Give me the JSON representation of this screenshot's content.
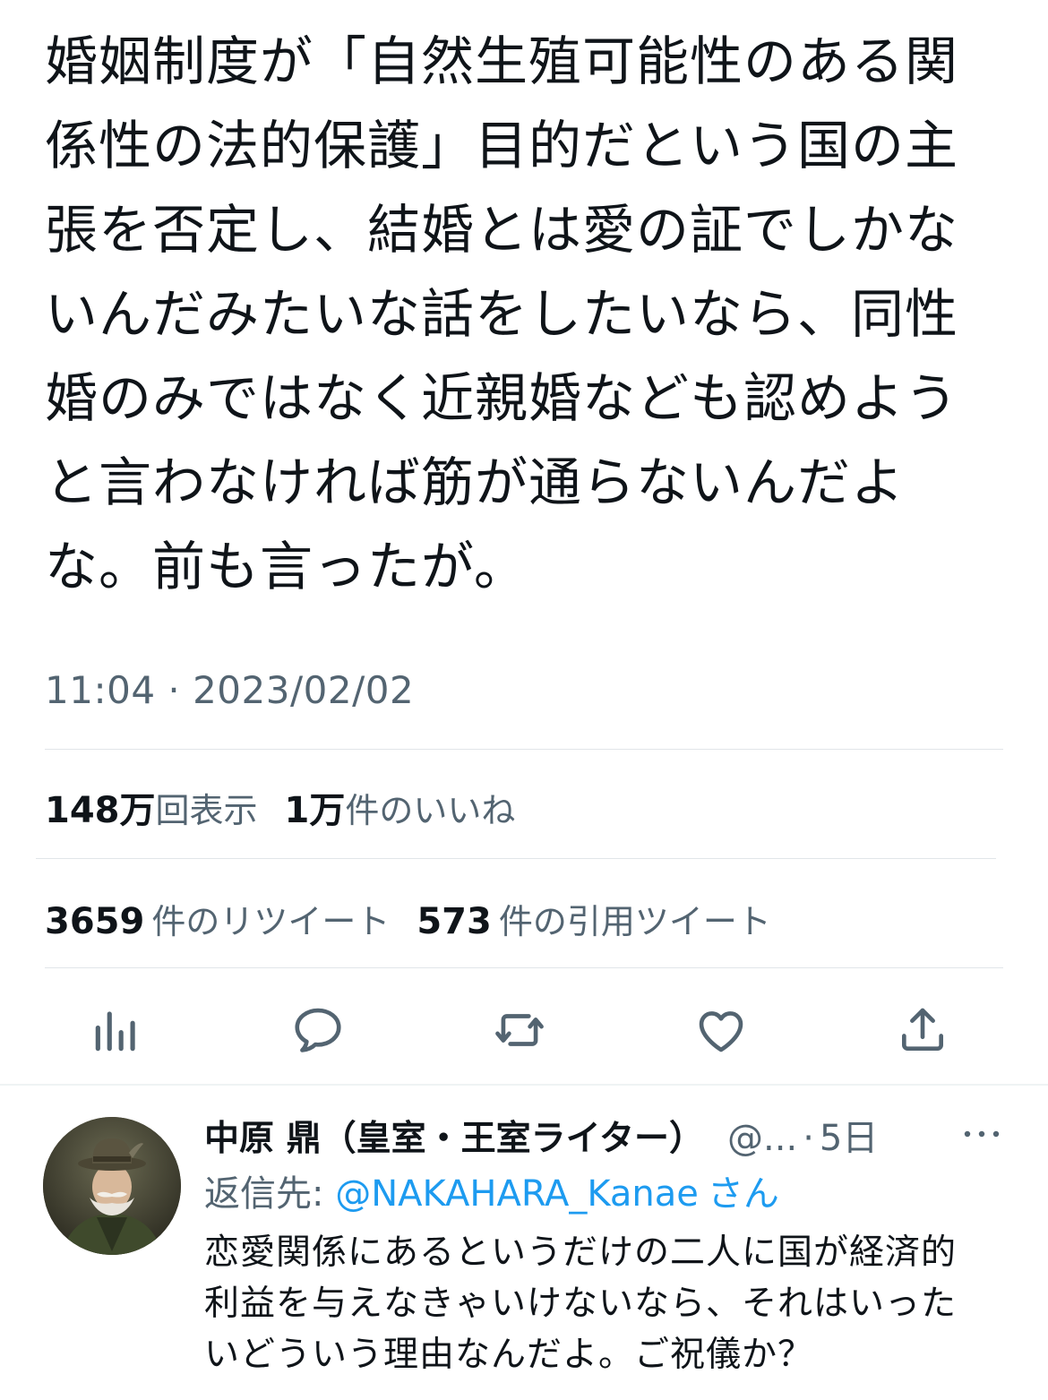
{
  "tweet": {
    "text": "婚姻制度が「自然生殖可能性のある関\n係性の法的保護」目的だという国の主\n張を否定し、結婚とは愛の証でしかな\nいんだみたいな話をしたいなら、同性\n婚のみではなく近親婚なども認めよう\nと言わなければ筋が通らないんだよ\nな。前も言ったが。",
    "timestamp": "11:04 · 2023/02/02"
  },
  "stats": {
    "views_count": "148万",
    "views_label": "回表示",
    "likes_count": "1万",
    "likes_label": "件のいいね",
    "retweets_count": "3659",
    "retweets_label": "件のリツイート",
    "quotes_count": "573",
    "quotes_label": "件の引用ツイート"
  },
  "actions": {
    "icons": [
      "analytics-icon",
      "reply-icon",
      "retweet-icon",
      "like-icon",
      "share-icon"
    ]
  },
  "reply": {
    "name": "中原 鼎（皇室・王室ライター）",
    "handle": "@...",
    "time": "5日",
    "reply_to_label": "返信先: ",
    "reply_to_mention": "@NAKAHARA_Kanae",
    "reply_to_suffix": "さん",
    "text": "恋愛関係にあるというだけの二人に国が経済的\n利益を与えなきゃいけないなら、それはいった\nいどういう理由なんだよ。ご祝儀か？"
  },
  "colors": {
    "text": "#0f1419",
    "secondary": "#536471",
    "link": "#1d9bf0",
    "divider": "#e1e5e9"
  }
}
